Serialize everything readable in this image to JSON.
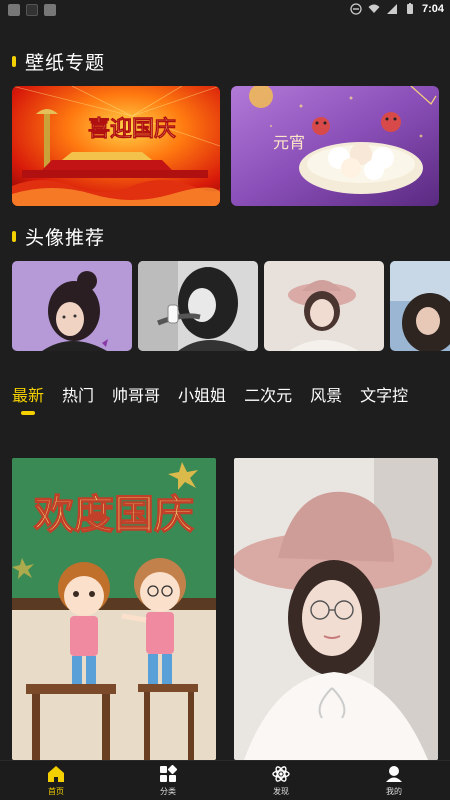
{
  "status_bar": {
    "time": "7:04"
  },
  "wallpaper_section": {
    "title": "壁纸专题",
    "items": [
      {
        "name": "national-day-wallpaper",
        "text": "喜迎国庆"
      },
      {
        "name": "lantern-festival-wallpaper",
        "text": ""
      }
    ]
  },
  "avatar_section": {
    "title": "头像推荐",
    "items": [
      "avatar-1",
      "avatar-2",
      "avatar-3",
      "avatar-4"
    ]
  },
  "tabs": [
    "最新",
    "热门",
    "帅哥哥",
    "小姐姐",
    "二次元",
    "风景",
    "文字控"
  ],
  "active_tab": "最新",
  "feed": [
    {
      "name": "celebrate-national-day-card",
      "caption": "欢度国庆"
    },
    {
      "name": "girl-with-hat-card",
      "caption": ""
    }
  ],
  "bottom_nav": [
    {
      "label": "首页",
      "icon": "home-icon",
      "active": true
    },
    {
      "label": "分类",
      "icon": "grid-icon",
      "active": false
    },
    {
      "label": "发现",
      "icon": "atom-icon",
      "active": false
    },
    {
      "label": "我的",
      "icon": "user-icon",
      "active": false
    }
  ],
  "colors": {
    "accent": "#f5d000",
    "background": "#1e1e1e"
  }
}
